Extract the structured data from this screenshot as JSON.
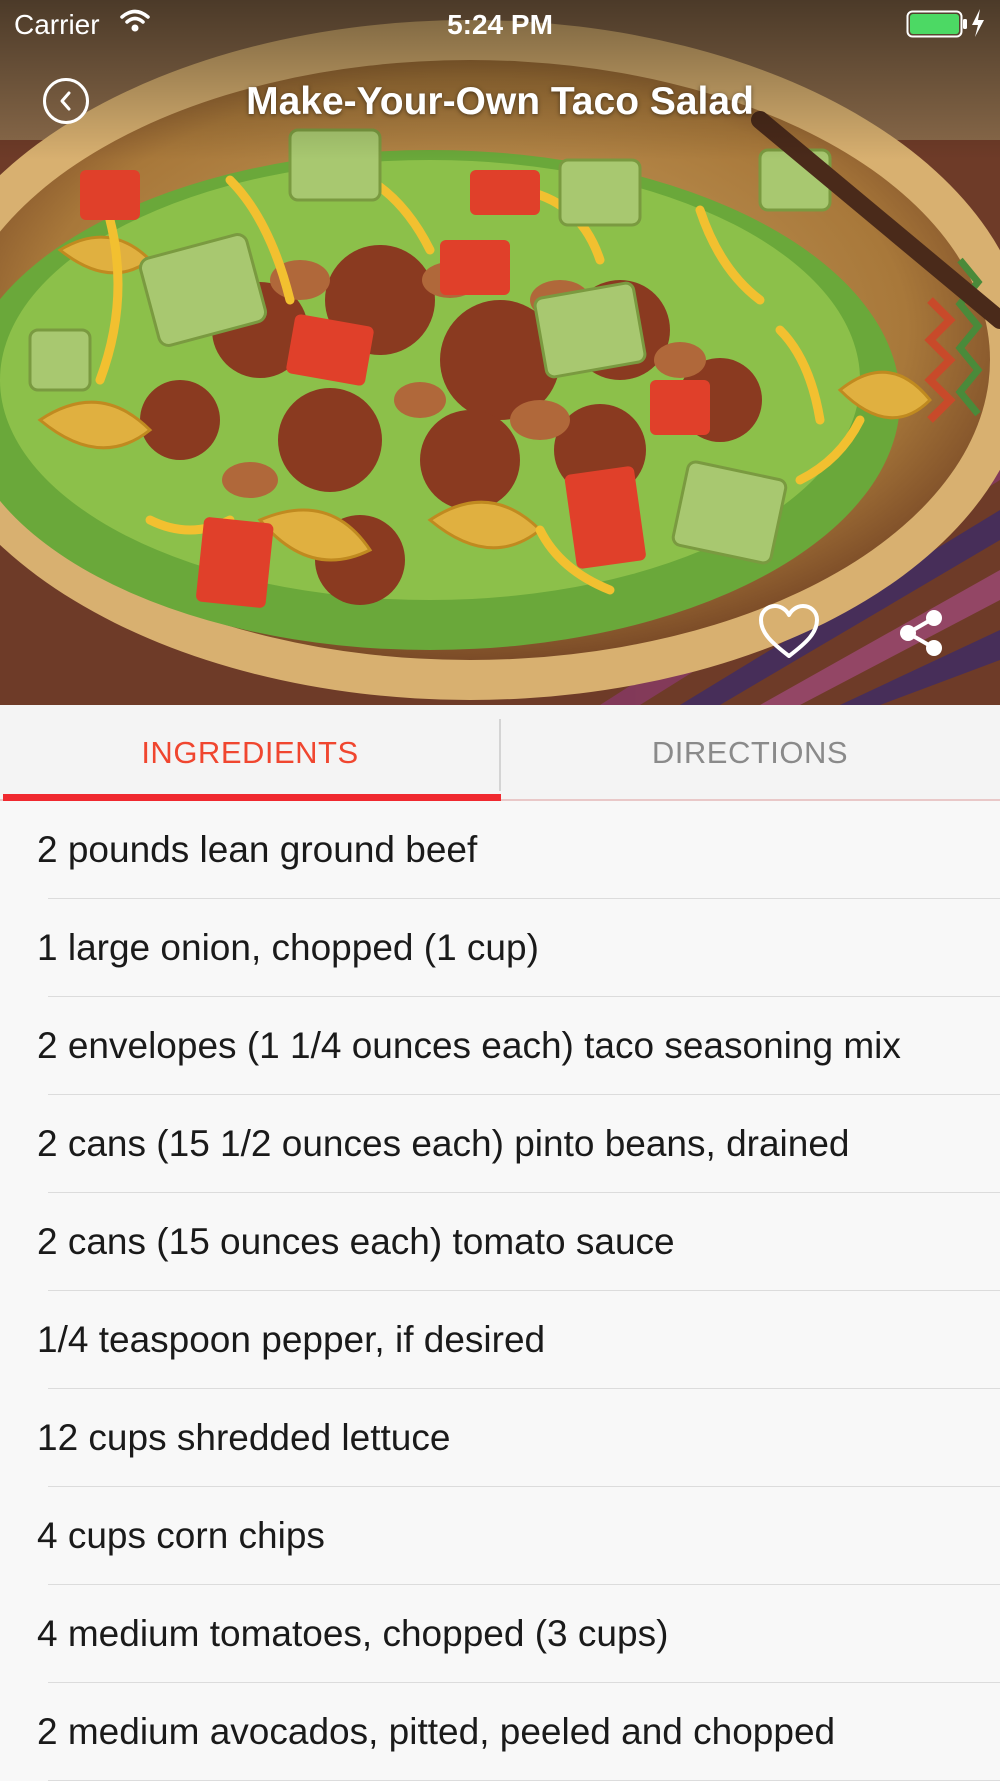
{
  "status_bar": {
    "carrier": "Carrier",
    "time": "5:24 PM"
  },
  "nav": {
    "title": "Make-Your-Own Taco Salad",
    "back_icon": "chevron-left-circle-icon"
  },
  "actions": {
    "favorite_icon": "heart-outline-icon",
    "share_icon": "share-icon"
  },
  "tabs": [
    {
      "label": "INGREDIENTS",
      "selected": true
    },
    {
      "label": "DIRECTIONS",
      "selected": false
    }
  ],
  "colors": {
    "accent": "#f0462f",
    "indicator": "#f0292f",
    "battery": "#4cd964"
  },
  "ingredients": [
    "2 pounds lean ground beef",
    "1 large onion, chopped (1 cup)",
    "2 envelopes (1 1/4 ounces each) taco seasoning mix",
    "2 cans (15 1/2 ounces each) pinto beans, drained",
    "2 cans (15 ounces each) tomato sauce",
    "1/4 teaspoon pepper, if desired",
    "12 cups shredded lettuce",
    "4 cups corn chips",
    "4 medium tomatoes, chopped (3 cups)",
    "2 medium avocados, pitted, peeled and chopped"
  ]
}
